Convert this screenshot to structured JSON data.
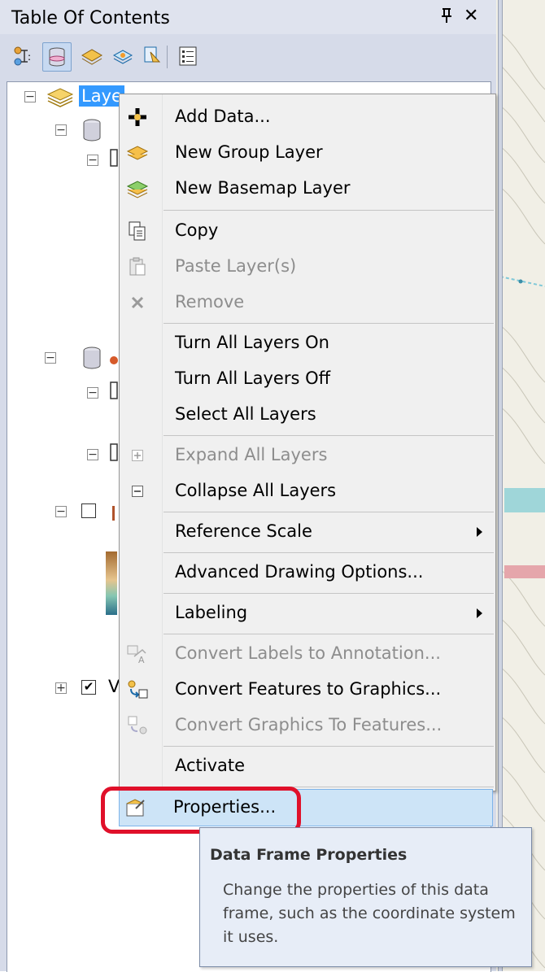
{
  "panel": {
    "title": "Table Of Contents",
    "pin_label": "ᴘ",
    "close_label": "✕"
  },
  "toolbar": {
    "buttons": [
      "list-by-drawing-order-icon",
      "list-by-source-icon",
      "list-by-visibility-icon",
      "list-by-selection-icon",
      "options-icon"
    ]
  },
  "tree": {
    "root_label": "Laye",
    "collapse_glyph": "−",
    "expand_glyph": "+",
    "checked_glyph": "✔",
    "partial_letter": "V"
  },
  "context_menu": {
    "items": [
      {
        "label": "Add Data...",
        "icon": "add-data-icon",
        "enabled": true
      },
      {
        "label": "New Group Layer",
        "icon": "group-layer-icon",
        "enabled": true
      },
      {
        "label": "New Basemap Layer",
        "icon": "basemap-layer-icon",
        "enabled": true
      },
      {
        "label": "Copy",
        "icon": "copy-icon",
        "enabled": true
      },
      {
        "label": "Paste Layer(s)",
        "icon": "paste-icon",
        "enabled": false
      },
      {
        "label": "Remove",
        "icon": "remove-icon",
        "enabled": false
      },
      {
        "label": "Turn All Layers On",
        "icon": "",
        "enabled": true
      },
      {
        "label": "Turn All Layers Off",
        "icon": "",
        "enabled": true
      },
      {
        "label": "Select All Layers",
        "icon": "",
        "enabled": true
      },
      {
        "label": "Expand All Layers",
        "icon": "expand-icon",
        "enabled": false
      },
      {
        "label": "Collapse All Layers",
        "icon": "collapse-icon",
        "enabled": true
      },
      {
        "label": "Reference Scale",
        "icon": "",
        "enabled": true,
        "submenu": true
      },
      {
        "label": "Advanced Drawing Options...",
        "icon": "",
        "enabled": true
      },
      {
        "label": "Labeling",
        "icon": "",
        "enabled": true,
        "submenu": true
      },
      {
        "label": "Convert Labels to Annotation...",
        "icon": "convert-labels-icon",
        "enabled": false
      },
      {
        "label": "Convert Features to Graphics...",
        "icon": "convert-features-icon",
        "enabled": true
      },
      {
        "label": "Convert Graphics To Features...",
        "icon": "convert-graphics-icon",
        "enabled": false
      },
      {
        "label": "Activate",
        "icon": "",
        "enabled": true
      },
      {
        "label": "Properties...",
        "icon": "properties-icon",
        "enabled": true,
        "highlighted": true
      }
    ]
  },
  "tooltip": {
    "title": "Data Frame Properties",
    "body": "Change the properties of this data frame, such as the coordinate system it uses."
  },
  "colors": {
    "selection_blue": "#3399ff",
    "highlight_fill": "#cde4f7",
    "annotation_red": "#e0102a"
  }
}
